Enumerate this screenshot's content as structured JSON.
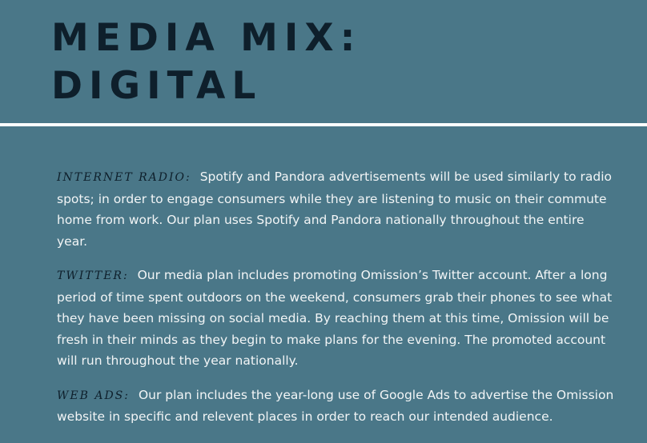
{
  "title": {
    "line1": "MEDIA MIX:",
    "line2": "DIGITAL"
  },
  "sections": [
    {
      "heading": "INTERNET RADIO:",
      "body": "Spotify and Pandora advertisements will be used similarly to radio spots; in order to engage consumers while they are listening to music on their commute home from work. Our plan uses Spotify and Pandora nationally throughout the entire year."
    },
    {
      "heading": "TWITTER:",
      "body": "Our media plan includes promoting Omission’s Twitter account. After a long period of time spent outdoors on the weekend, consumers grab their phones to see what they have been missing on social media. By reaching them at this time, Omission will be fresh in their minds as they begin to make plans for the evening. The promoted account will run throughout the year nationally."
    },
    {
      "heading": "WEB ADS:",
      "body": "Our plan includes the year-long use of Google Ads to advertise the Omission website in specific and relevent places in order to reach our intended audience."
    }
  ]
}
